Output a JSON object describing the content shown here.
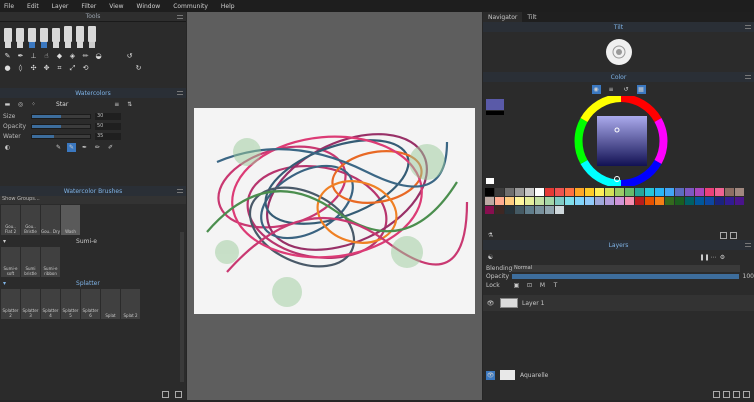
{
  "menu": [
    "File",
    "Edit",
    "Layer",
    "Filter",
    "View",
    "Window",
    "Community",
    "Help"
  ],
  "tools_panel": {
    "title": "Tools"
  },
  "watercolors_panel": {
    "title": "Watercolors",
    "preset": "Star",
    "sliders": [
      {
        "label": "Size",
        "value": "30",
        "fill": 0.5
      },
      {
        "label": "Opacity",
        "value": "50",
        "fill": 0.5
      },
      {
        "label": "Water",
        "value": "35",
        "fill": 0.38
      }
    ]
  },
  "brushes_panel": {
    "title": "Watercolor Brushes",
    "show_groups": "Show Groups...",
    "gouache": [
      "Gou.. Flat 2",
      "Gou.. Bristle",
      "Gou.. Dry",
      "Wash"
    ],
    "sumi_title": "Sumi-e",
    "sumi": [
      "Sumi-e soft",
      "Sumi bristle",
      "Sumi-e ribbon"
    ],
    "splatter_title": "Splatter",
    "splatter": [
      "Splatter 2",
      "Splatter 3",
      "Splatter 4",
      "Splatter 5",
      "Splatter 6",
      "Splat",
      "Splat 2"
    ]
  },
  "right_tabs": {
    "navigator": "Navigator",
    "tilt": "Tilt"
  },
  "tilt_panel": {
    "title": "Tilt"
  },
  "color_panel": {
    "title": "Color",
    "hue_color": "#2c2bd0",
    "current_color": "#5a5aa8"
  },
  "palette": [
    "#000000",
    "#3c3c3c",
    "#6e6e6e",
    "#9a9a9a",
    "#c8c8c8",
    "#ffffff",
    "#e53935",
    "#ef5350",
    "#ff7043",
    "#ffa726",
    "#ffca28",
    "#ffee58",
    "#d4e157",
    "#9ccc65",
    "#66bb6a",
    "#26a69a",
    "#26c6da",
    "#29b6f6",
    "#42a5f5",
    "#5c6bc0",
    "#7e57c2",
    "#ab47bc",
    "#ec407a",
    "#f06292",
    "#8d6e63",
    "#a1887f",
    "#bcaaa4",
    "#ffab91",
    "#ffcc80",
    "#fff59d",
    "#e6ee9c",
    "#c5e1a5",
    "#a5d6a7",
    "#80cbc4",
    "#80deea",
    "#81d4fa",
    "#90caf9",
    "#9fa8da",
    "#b39ddb",
    "#ce93d8",
    "#f48fb1",
    "#b71c1c",
    "#e65100",
    "#f57f17",
    "#33691e",
    "#1b5e20",
    "#006064",
    "#01579b",
    "#0d47a1",
    "#1a237e",
    "#311b92",
    "#4a148c",
    "#880e4f",
    "#3e2723",
    "#263238",
    "#455a64",
    "#607d8b",
    "#78909c",
    "#90a4ae",
    "#cfd8dc"
  ],
  "layers_panel": {
    "title": "Layers",
    "blending_label": "Blending",
    "blending_value": "Normal",
    "opacity_label": "Opacity",
    "opacity_value": "100",
    "opacity_fill": 1.0,
    "lock_label": "Lock",
    "layer_name": "Layer 1",
    "paper_name": "Aquarelle"
  }
}
